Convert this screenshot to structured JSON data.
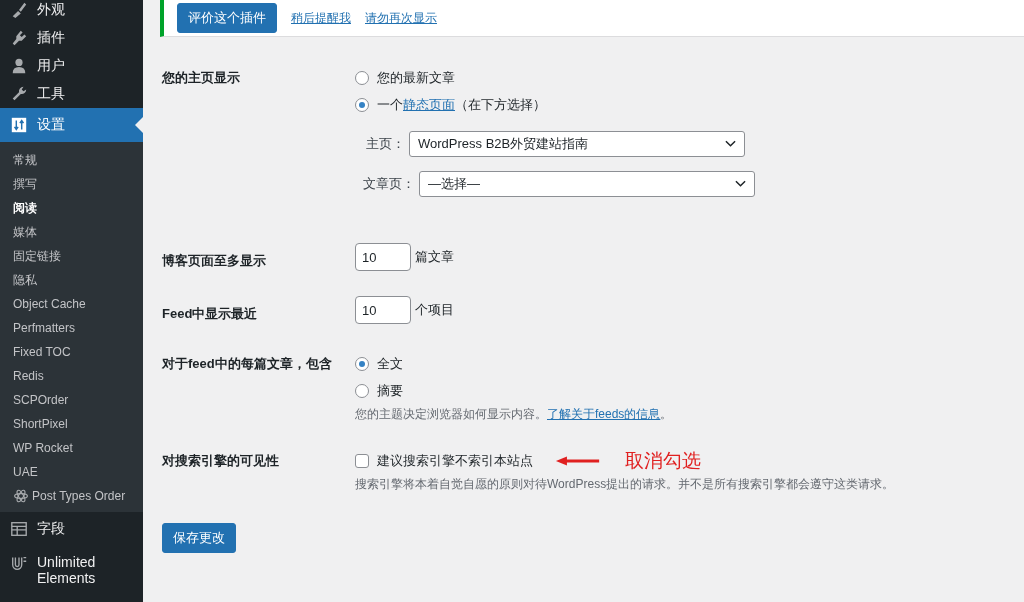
{
  "sidebar": {
    "top": [
      {
        "label": "外观",
        "selected": false
      },
      {
        "label": "插件",
        "selected": false
      },
      {
        "label": "用户",
        "selected": false
      },
      {
        "label": "工具",
        "selected": false
      },
      {
        "label": "设置",
        "selected": true
      }
    ],
    "submenu": [
      {
        "label": "常规",
        "selected": false
      },
      {
        "label": "撰写",
        "selected": false
      },
      {
        "label": "阅读",
        "selected": true
      },
      {
        "label": "媒体",
        "selected": false
      },
      {
        "label": "固定链接",
        "selected": false
      },
      {
        "label": "隐私",
        "selected": false
      },
      {
        "label": "Object Cache",
        "selected": false
      },
      {
        "label": "Perfmatters",
        "selected": false
      },
      {
        "label": "Fixed TOC",
        "selected": false
      },
      {
        "label": "Redis",
        "selected": false
      },
      {
        "label": "SCPOrder",
        "selected": false
      },
      {
        "label": "ShortPixel",
        "selected": false
      },
      {
        "label": "WP Rocket",
        "selected": false
      },
      {
        "label": "UAE",
        "selected": false
      },
      {
        "label": "Post Types Order",
        "selected": false
      }
    ],
    "bottom": [
      {
        "label": "字段",
        "selected": false
      },
      {
        "label": "Unlimited Elements",
        "selected": false
      }
    ]
  },
  "notice": {
    "buttons": [
      {
        "label": "评价这个插件",
        "kind": "primary"
      },
      {
        "label": "稍后提醒我",
        "kind": "link"
      },
      {
        "label": "请勿再次显示",
        "kind": "link"
      }
    ]
  },
  "form": {
    "rows": [
      {
        "kind": "radio",
        "label": "您的主页显示",
        "options": [
          {
            "text": "您的最新文章",
            "selected": false
          },
          {
            "text": "一个",
            "link": "静态页面",
            "suffix": "（在下方选择）",
            "selected": true
          }
        ],
        "selects": [
          {
            "label": "主页：",
            "value": "WordPress B2B外贸建站指南"
          },
          {
            "label": "文章页：",
            "value": "—选择—"
          }
        ]
      },
      {
        "kind": "number",
        "label": "博客页面至多显示",
        "value": "10",
        "unit": "篇文章"
      },
      {
        "kind": "number",
        "label": "Feed中显示最近",
        "value": "10",
        "unit": "个项目"
      },
      {
        "kind": "radio",
        "label": "对于feed中的每篇文章，包含",
        "options": [
          {
            "text": "全文",
            "selected": true
          },
          {
            "text": "摘要",
            "selected": false
          }
        ],
        "description": {
          "text": "您的主题决定浏览器如何显示内容。",
          "link": "了解关于feeds的信息",
          "suffix": "。"
        }
      },
      {
        "kind": "checkbox",
        "label": "对搜索引擎的可见性",
        "option": {
          "text": "建议搜索引擎不索引本站点",
          "checked": false
        },
        "annotation": "取消勾选",
        "description": {
          "text": "搜索引擎将本着自觉自愿的原则对待WordPress提出的请求。并不是所有搜索引擎都会遵守这类请求。"
        }
      }
    ]
  },
  "save_button": "保存更改"
}
